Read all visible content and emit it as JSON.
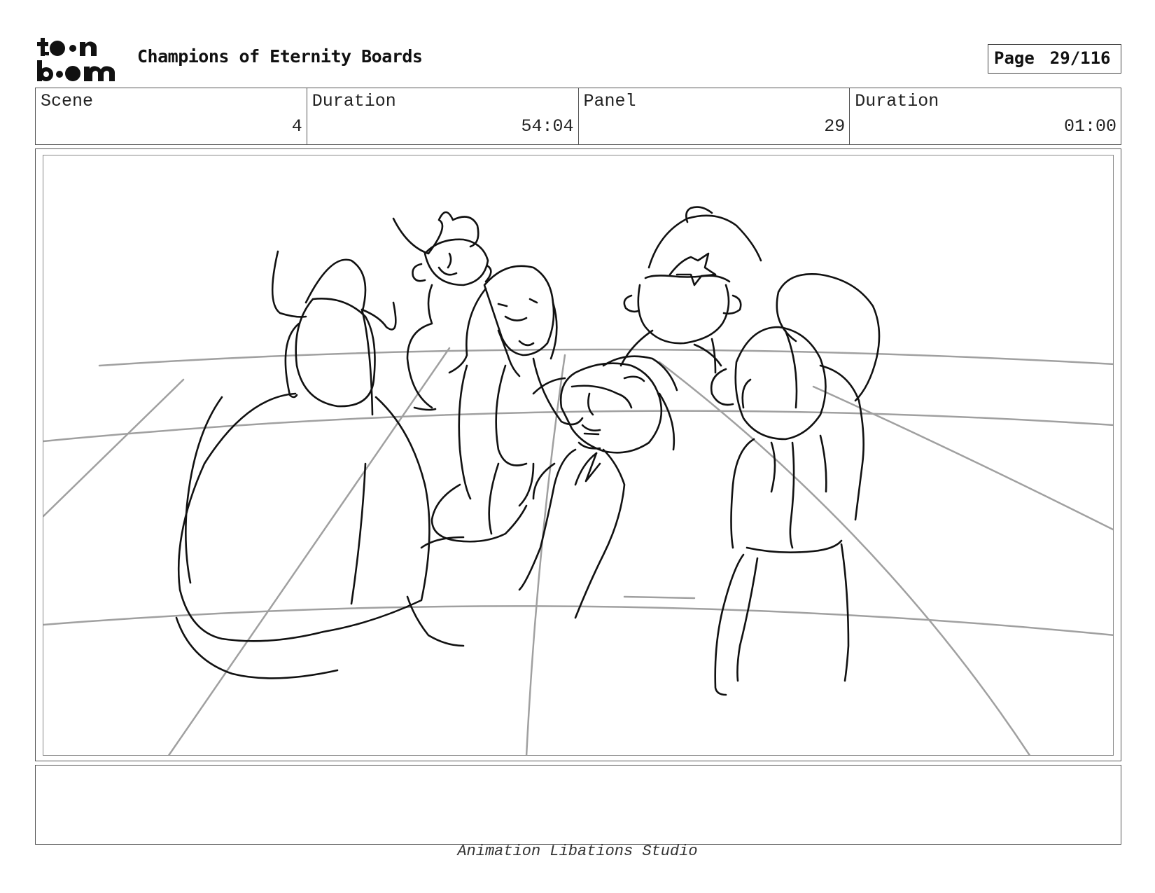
{
  "header": {
    "logo_text": "toon boom",
    "title": "Champions of Eternity Boards",
    "page_label": "Page",
    "page_number": "29/116"
  },
  "info": {
    "scene_label": "Scene",
    "scene_value": "4",
    "scene_duration_label": "Duration",
    "scene_duration_value": "54:04",
    "panel_label": "Panel",
    "panel_value": "29",
    "panel_duration_label": "Duration",
    "panel_duration_value": "01:00"
  },
  "notes": {
    "text": ""
  },
  "footer": {
    "studio": "Animation Libations Studio"
  },
  "colors": {
    "ink": "#111111",
    "guide": "#a0a0a0",
    "border": "#555555"
  }
}
